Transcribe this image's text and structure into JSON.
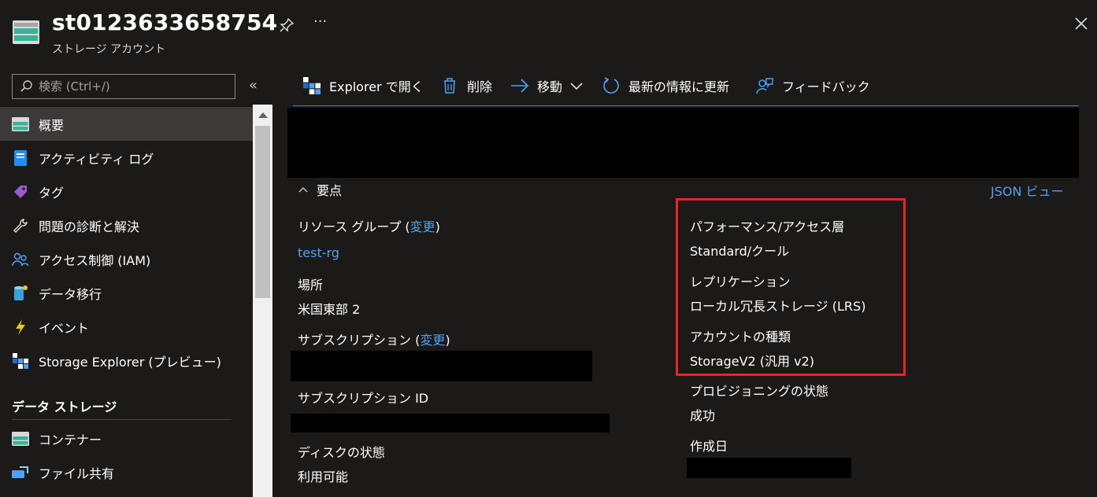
{
  "header": {
    "title": "st0123633658754",
    "subtitle": "ストレージ アカウント",
    "more_label": "···"
  },
  "sidebar": {
    "search_placeholder": "検索 (Ctrl+/)",
    "collapse_label": "«",
    "items": [
      {
        "label": "概要",
        "icon": "storage-account-icon"
      },
      {
        "label": "アクティビティ ログ",
        "icon": "activity-log-icon"
      },
      {
        "label": "タグ",
        "icon": "tag-icon"
      },
      {
        "label": "問題の診断と解決",
        "icon": "wrench-icon"
      },
      {
        "label": "アクセス制御 (IAM)",
        "icon": "people-icon"
      },
      {
        "label": "データ移行",
        "icon": "data-migration-icon"
      },
      {
        "label": "イベント",
        "icon": "lightning-icon"
      },
      {
        "label": "Storage Explorer (プレビュー)",
        "icon": "storage-explorer-icon"
      }
    ],
    "section_title": "データ ストレージ",
    "section_items": [
      {
        "label": "コンテナー",
        "icon": "container-icon"
      },
      {
        "label": "ファイル共有",
        "icon": "file-share-icon"
      }
    ]
  },
  "toolbar": {
    "explorer": "Explorer で開く",
    "delete": "削除",
    "move": "移動",
    "refresh": "最新の情報に更新",
    "feedback": "フィードバック"
  },
  "essentials": {
    "toggle_label": "要点",
    "json_view": "JSON ビュー",
    "left": {
      "resource_group_label": "リソース グループ (",
      "change_label": "変更",
      "close_paren": ")",
      "resource_group_value": "test-rg",
      "location_label": "場所",
      "location_value": "米国東部 2",
      "subscription_label": "サブスクリプション (",
      "subscription_id_label": "サブスクリプション ID",
      "disk_state_label": "ディスクの状態",
      "disk_state_value": "利用可能"
    },
    "right": {
      "performance_label": "パフォーマンス/アクセス層",
      "performance_value": "Standard/クール",
      "replication_label": "レプリケーション",
      "replication_value": "ローカル冗長ストレージ (LRS)",
      "account_kind_label": "アカウントの種類",
      "account_kind_value": "StorageV2 (汎用 v2)",
      "provisioning_label": "プロビジョニングの状態",
      "provisioning_value": "成功",
      "created_label": "作成日"
    }
  },
  "colors": {
    "background": "#1b1a19",
    "link": "#4ea1f5",
    "highlight": "#e8242a",
    "active_item": "#3b3a39"
  }
}
